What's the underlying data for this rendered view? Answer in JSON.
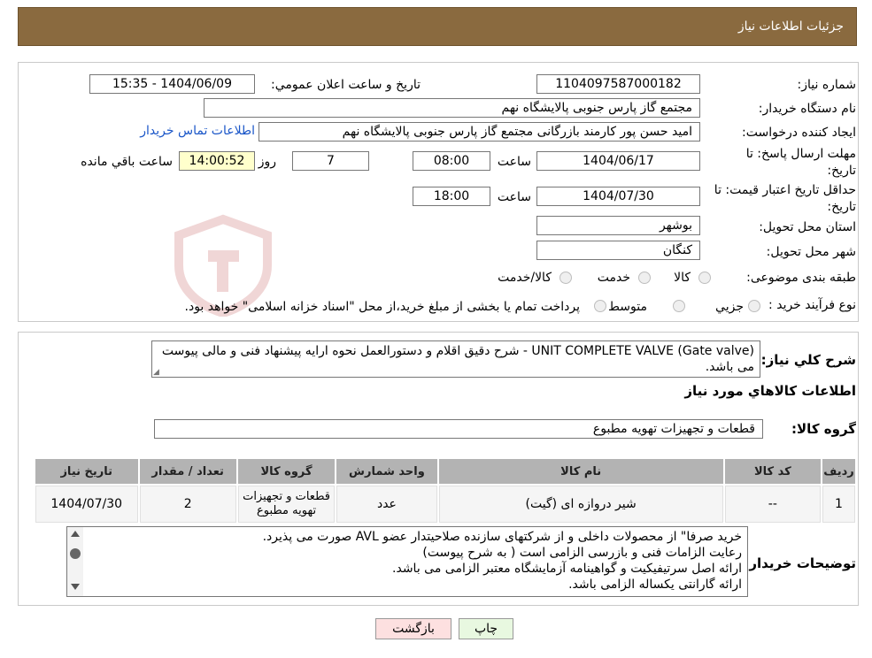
{
  "header": {
    "title": "جزئیات اطلاعات نیاز"
  },
  "form": {
    "need_number_label": "شماره نیاز:",
    "need_number": "1104097587000182",
    "announce_label": "تاریخ و ساعت اعلان عمومي:",
    "announce_value": "1404/06/09 - 15:35",
    "buyer_org_label": "نام دستگاه خريدار:",
    "buyer_org": "مجتمع گاز پارس جنوبی  پالایشگاه نهم",
    "creator_label": "ايجاد كننده درخواست:",
    "creator": "امید حسن پور کارمند بازرگانی مجتمع گاز پارس جنوبی  پالایشگاه نهم",
    "contact_link": "اطلاعات تماس خريدار",
    "reply_deadline_label_1": "مهلت ارسال پاسخ: تا",
    "reply_deadline_label_2": "تاريخ:",
    "reply_date": "1404/06/17",
    "time_label": "ساعت",
    "reply_time": "08:00",
    "days_value": "7",
    "days_label": "روز و",
    "remaining_time": "14:00:52",
    "remaining_label": "ساعت باقي مانده",
    "validity_label_1": "حداقل تاريخ اعتبار قيمت: تا",
    "validity_label_2": "تاريخ:",
    "validity_date": "1404/07/30",
    "validity_time_label": "ساعت",
    "validity_time": "18:00",
    "province_label": "استان محل تحويل:",
    "province": "بوشهر",
    "city_label": "شهر محل تحويل:",
    "city": "کنگان",
    "category_label": "طبقه بندی موضوعی:",
    "category_options": [
      "کالا",
      "خدمت",
      "کالا/خدمت"
    ],
    "process_label": "نوع فرآيند خريد :",
    "process_options": [
      "جزيي",
      "متوسط"
    ],
    "process_note": "پرداخت تمام یا بخشی از مبلغ خرید،از محل \"اسناد خزانه اسلامی\" خواهد بود."
  },
  "summary": {
    "label": "شرح كلي نياز:",
    "text": "UNIT COMPLETE VALVE (Gate valve) - شرح دقیق اقلام و دستورالعمل نحوه ارایه پیشنهاد فنی و مالی پیوست می باشد.",
    "goods_info_title": "اطلاعات كالاهاي مورد نياز",
    "group_label": "گروه كالا:",
    "group_value": "قطعات و تجهیزات تهویه مطبوع"
  },
  "table": {
    "headers": [
      "رديف",
      "كد كالا",
      "نام كالا",
      "واحد شمارش",
      "گروه كالا",
      "تعداد / مقدار",
      "تاريخ نياز"
    ],
    "rows": [
      [
        "1",
        "--",
        "شیر دروازه ای (گیت)",
        "عدد",
        "قطعات و تجهیزات تهویه مطبوع",
        "2",
        "1404/07/30"
      ]
    ]
  },
  "buyer_notes": {
    "label": "توضيحات خريدار:",
    "lines": [
      "خرید صرفا\" از محصولات داخلی و از شرکتهای سازنده صلاحیتدار عضو AVL صورت می پذیرد.",
      "رعایت الزامات فنی و بازرسی الزامی است ( به شرح پیوست)",
      "ارائه اصل سرتیفیکیت و گواهینامه آزمایشگاه معتبر الزامی می باشد.",
      "ارائه گارانتی یکساله الزامی باشد."
    ]
  },
  "buttons": {
    "print": "چاپ",
    "back": "بازگشت"
  },
  "colors": {
    "header_bg": "#8a6a3f",
    "link": "#1a56c8",
    "back_btn": "#fde0e0",
    "print_btn": "#e8f8e0",
    "timer_bg": "#ffffcc"
  }
}
